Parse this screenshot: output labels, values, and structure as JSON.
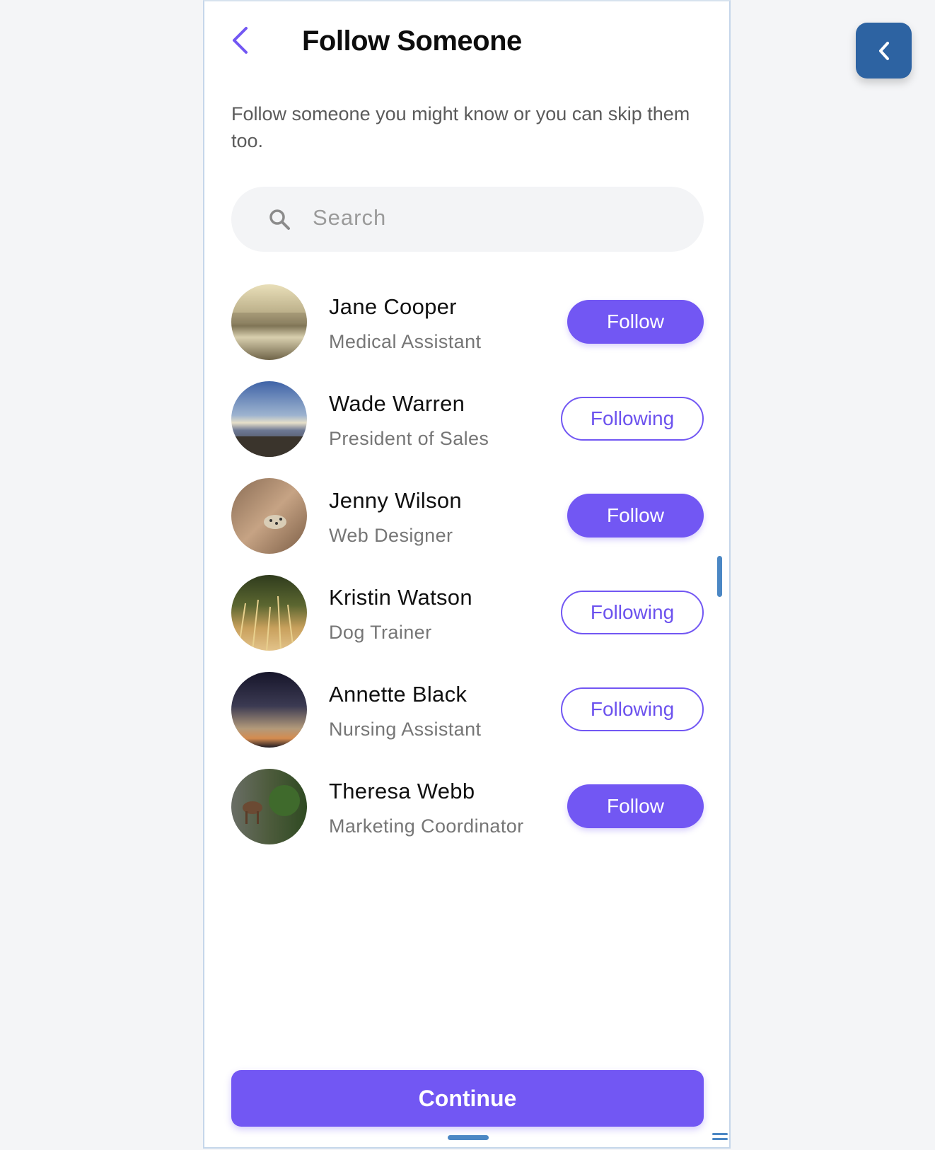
{
  "header": {
    "title": "Follow Someone",
    "back_icon": "chevron-left-icon",
    "accent_color": "#7257f3"
  },
  "intro": {
    "text": "Follow someone you might know or you can skip them too."
  },
  "search": {
    "placeholder": "Search",
    "icon": "search-icon"
  },
  "people": [
    {
      "name": "Jane Cooper",
      "role": "Medical Assistant",
      "button": "Follow",
      "state": "follow"
    },
    {
      "name": "Wade Warren",
      "role": "President of Sales",
      "button": "Following",
      "state": "following"
    },
    {
      "name": "Jenny Wilson",
      "role": "Web Designer",
      "button": "Follow",
      "state": "follow"
    },
    {
      "name": "Kristin Watson",
      "role": "Dog Trainer",
      "button": "Following",
      "state": "following"
    },
    {
      "name": "Annette Black",
      "role": "Nursing Assistant",
      "button": "Following",
      "state": "following"
    },
    {
      "name": "Theresa Webb",
      "role": "Marketing Coordinator",
      "button": "Follow",
      "state": "follow"
    }
  ],
  "footer": {
    "continue_label": "Continue"
  },
  "side_panel": {
    "collapse_icon": "chevron-left-icon",
    "color": "#2d63a2"
  }
}
